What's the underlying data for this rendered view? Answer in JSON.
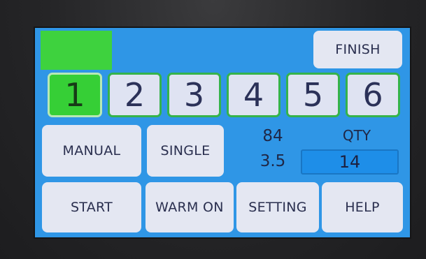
{
  "header": {
    "finish_label": "FINISH"
  },
  "programs": [
    "1",
    "2",
    "3",
    "4",
    "5",
    "6"
  ],
  "mode": {
    "manual_label": "MANUAL",
    "single_label": "SINGLE"
  },
  "readouts": {
    "value_top": "84",
    "value_bottom": "3.5",
    "qty_label": "QTY",
    "qty_value": "14"
  },
  "footer": {
    "start_label": "START",
    "warm_label": "WARM ON",
    "setting_label": "SETTING",
    "help_label": "HELP"
  },
  "colors": {
    "screen": "#2f96e6",
    "active_green": "#36cf36",
    "border_green": "#35b34a",
    "button_bg": "#e4e7f2"
  }
}
